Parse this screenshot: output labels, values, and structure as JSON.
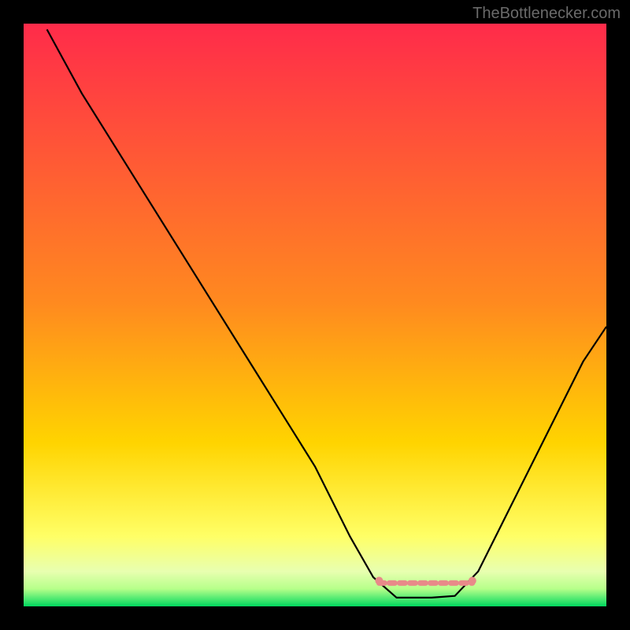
{
  "watermark": "TheBottlenecker.com",
  "chart_data": {
    "type": "line",
    "title": "",
    "xlabel": "",
    "ylabel": "",
    "xlim": [
      0,
      100
    ],
    "ylim": [
      0,
      100
    ],
    "background_gradient": {
      "top": "#ff2b4a",
      "mid": "#ffd400",
      "low": "#ffff66",
      "bottom": "#00d85e"
    },
    "curve": {
      "color": "#000000",
      "points": [
        {
          "x": 4,
          "y": 99
        },
        {
          "x": 10,
          "y": 88
        },
        {
          "x": 20,
          "y": 72
        },
        {
          "x": 30,
          "y": 56
        },
        {
          "x": 40,
          "y": 40
        },
        {
          "x": 50,
          "y": 24
        },
        {
          "x": 56,
          "y": 12
        },
        {
          "x": 60,
          "y": 5
        },
        {
          "x": 64,
          "y": 1.5
        },
        {
          "x": 70,
          "y": 1.5
        },
        {
          "x": 74,
          "y": 1.8
        },
        {
          "x": 78,
          "y": 6
        },
        {
          "x": 84,
          "y": 18
        },
        {
          "x": 90,
          "y": 30
        },
        {
          "x": 96,
          "y": 42
        },
        {
          "x": 100,
          "y": 48
        }
      ]
    },
    "highlight_band": {
      "color": "#e88a89",
      "y": 4,
      "x_start": 61,
      "x_end": 77,
      "dot_radius": 4
    }
  }
}
